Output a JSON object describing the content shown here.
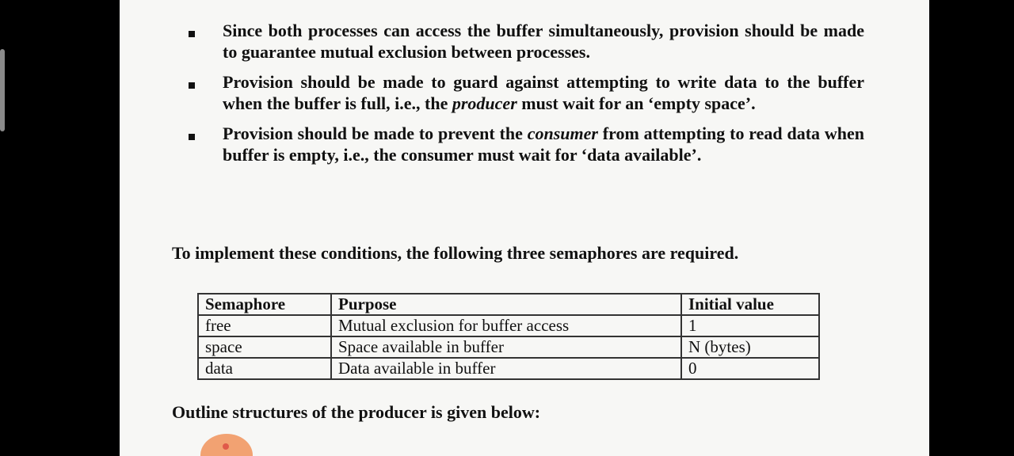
{
  "bullets": [
    {
      "text": "Since both processes can access the buffer simultaneously, provision should be made to guarantee mutual exclusion between processes."
    },
    {
      "pre": "Provision should be made to guard against attempting to write data to the buffer when the buffer is full, i.e., the ",
      "em": "producer",
      "post": " must wait for an ‘empty space’."
    },
    {
      "pre": "Provision should be made to prevent the ",
      "em": "consumer",
      "post": " from attempting to read data when buffer is empty, i.e., the consumer must wait for ‘data available’."
    }
  ],
  "intro": "To implement these conditions, the following three semaphores are required.",
  "table": {
    "headers": [
      "Semaphore",
      "Purpose",
      "Initial value"
    ],
    "rows": [
      [
        "free",
        "Mutual exclusion for buffer access",
        "1"
      ],
      [
        "space",
        "Space available in buffer",
        "N (bytes)"
      ],
      [
        "data",
        "Data available in buffer",
        "0"
      ]
    ]
  },
  "outline": "Outline structures of the producer is given below:"
}
